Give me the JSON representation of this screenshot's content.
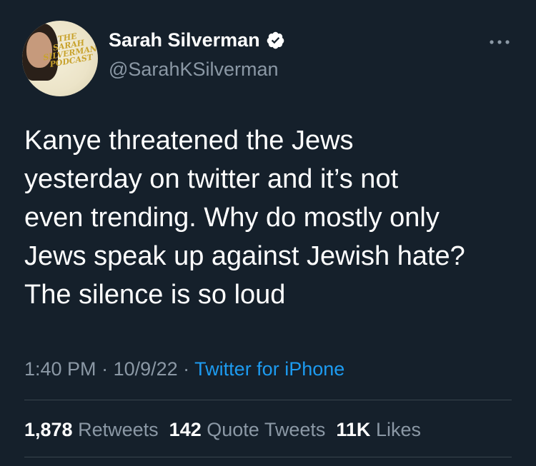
{
  "author": {
    "name": "Sarah Silverman",
    "handle": "@SarahKSilverman",
    "verified": true,
    "avatar_text": [
      "THE",
      "SARAH",
      "SILVERMAN",
      "PODCAST"
    ]
  },
  "tweet": {
    "text": "Kanye threatened the Jews\nyesterday on twitter and it’s not\neven trending.  Why do mostly only\nJews speak up against Jewish hate?\nThe silence is so loud"
  },
  "meta": {
    "time": "1:40 PM",
    "sep1": " · ",
    "date": "10/9/22",
    "sep2": " · ",
    "source": "Twitter for iPhone"
  },
  "stats": {
    "retweets_count": "1,878",
    "retweets_label": "Retweets",
    "quotes_count": "142",
    "quotes_label": "Quote Tweets",
    "likes_count": "11K",
    "likes_label": "Likes"
  },
  "colors": {
    "background": "#15202b",
    "secondary_text": "#8b98a5",
    "link": "#1d9bf0",
    "divider": "#38444d"
  }
}
